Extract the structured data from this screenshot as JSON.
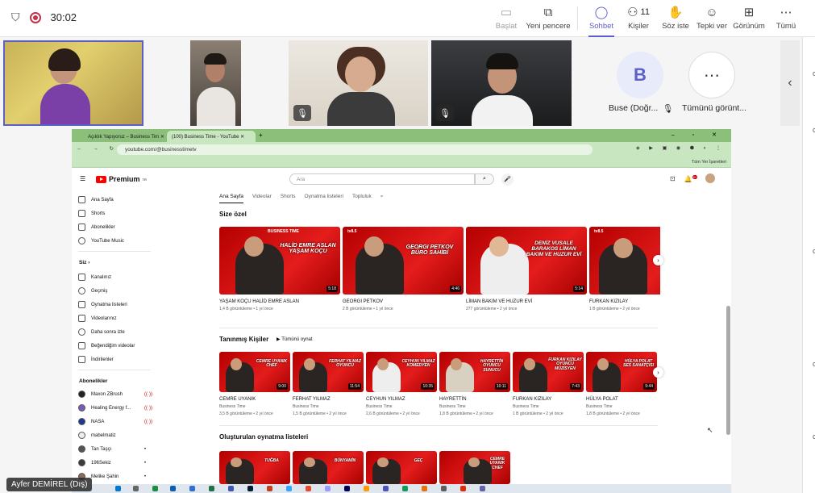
{
  "teams": {
    "timer": "30:02",
    "toolbar": [
      {
        "label": "Başlat",
        "icon": "monitor-icon",
        "state": "disabled"
      },
      {
        "label": "Yeni pencere",
        "icon": "new-window-icon",
        "state": "normal"
      },
      {
        "label": "Sohbet",
        "icon": "chat-icon",
        "state": "selected"
      },
      {
        "label": "Kişiler",
        "icon": "people-icon",
        "state": "normal",
        "count": "11"
      },
      {
        "label": "Söz iste",
        "icon": "raise-hand-icon",
        "state": "normal"
      },
      {
        "label": "Tepki ver",
        "icon": "react-icon",
        "state": "normal"
      },
      {
        "label": "Görünüm",
        "icon": "view-icon",
        "state": "normal"
      },
      {
        "label": "Tümü",
        "icon": "more-icon",
        "state": "normal"
      }
    ],
    "participants": {
      "buse_initial": "B",
      "buse_name": "Buse (Doğr...",
      "more_label": "Tümünü görünt..."
    },
    "presenter_name": "Ayfer DEMİREL (Dış)"
  },
  "browser": {
    "tab1": "Açıklık Yapıyoruz – Business Tim",
    "tab2": "(100) Business Time - YouTube",
    "url": "youtube.com/@businesstimetv",
    "bookmarks": "Tüm Yer İşaretleri"
  },
  "youtube": {
    "logo": "Premium",
    "logo_sup": "TR",
    "search_placeholder": "Ara",
    "notif_count": "9+",
    "nav": [
      "Ana Sayfa",
      "Shorts",
      "Abonelikler",
      "YouTube Music"
    ],
    "you_header": "Siz",
    "you_items": [
      "Kanalınız",
      "Geçmiş",
      "Oynatma listeleri",
      "Videolarınız",
      "Daha sonra izle",
      "Beğendiğim videolar",
      "İndirilenler"
    ],
    "subs_header": "Abonelikler",
    "subs": [
      "Maxon ZBrush",
      "Healing Energy f...",
      "NASA",
      "mabelmatiz",
      "Tan Taşçı",
      "196Sekiz",
      "Melike Şahin"
    ],
    "channel_tabs": [
      "Ana Sayfa",
      "Videolar",
      "Shorts",
      "Oynatma listeleri",
      "Topluluk"
    ],
    "section1": "Size özel",
    "row1": [
      {
        "title": "YAŞAM KOÇU HALİD EMRE ASLAN",
        "meta": "1,4 B görüntüleme • 1 yıl önce",
        "dur": "5:18",
        "thumb": "HALİD EMRE ASLAN YAŞAM KOÇU"
      },
      {
        "title": "GEORGI PETKOV",
        "meta": "2 B görüntüleme • 1 yıl önce",
        "dur": "4:46",
        "thumb": "GEORGI PETKOV BÜRO SAHİBİ"
      },
      {
        "title": "LİMAN BAKIM VE HUZUR EVİ",
        "meta": "277 görüntüleme • 2 yıl önce",
        "dur": "5:14",
        "thumb": "DENİZ VUSALE BARAKOS LİMAN BAKIM VE HUZUR EVİ"
      },
      {
        "title": "FURKAN KIZILAY",
        "meta": "1 B görüntüleme • 2 yıl önce",
        "dur": "",
        "thumb": ""
      }
    ],
    "section2": "Tanınmış Kişiler",
    "play_all": "Tümünü oynat",
    "row2": [
      {
        "title": "CEMRE UYANIK",
        "ch": "Business Time",
        "meta": "3,5 B görüntüleme • 2 yıl önce",
        "dur": "9:00",
        "thumb": "CEMRE UYANIK CHEF"
      },
      {
        "title": "FERHAT YILMAZ",
        "ch": "Business Time",
        "meta": "1,5 B görüntüleme • 2 yıl önce",
        "dur": "11:54",
        "thumb": "FERHAT YILMAZ OYUNCU"
      },
      {
        "title": "CEYHUN YILMAZ",
        "ch": "Business Time",
        "meta": "2,6 B görüntüleme • 2 yıl önce",
        "dur": "10:35",
        "thumb": "CEYHUN YILMAZ KOMEDYEN"
      },
      {
        "title": "HAYRETTİN",
        "ch": "Business Time",
        "meta": "1,8 B görüntüleme • 2 yıl önce",
        "dur": "10:11",
        "thumb": "HAYRETTİN OYUNCU SUNUCU"
      },
      {
        "title": "FURKAN KIZILAY",
        "ch": "Business Time",
        "meta": "1 B görüntüleme • 2 yıl önce",
        "dur": "7:43",
        "thumb": "FURKAN KIZILAY OYUNCU MÜZİSYEN"
      },
      {
        "title": "HÜLYA POLAT",
        "ch": "Business Time",
        "meta": "1,8 B görüntüleme • 2 yıl önce",
        "dur": "9:44",
        "thumb": "HÜLYA POLAT SES SANATÇISI"
      }
    ],
    "section3": "Oluşturulan oynatma listeleri",
    "row3": [
      "TUĞBA",
      "BÜNYAMİN",
      "GEÇ",
      "CEMRE UYANIK CHEF"
    ]
  },
  "colors": {
    "teams_accent": "#5b5fc7",
    "yt_red": "#ff0000",
    "thumb_red": "#d81515"
  }
}
